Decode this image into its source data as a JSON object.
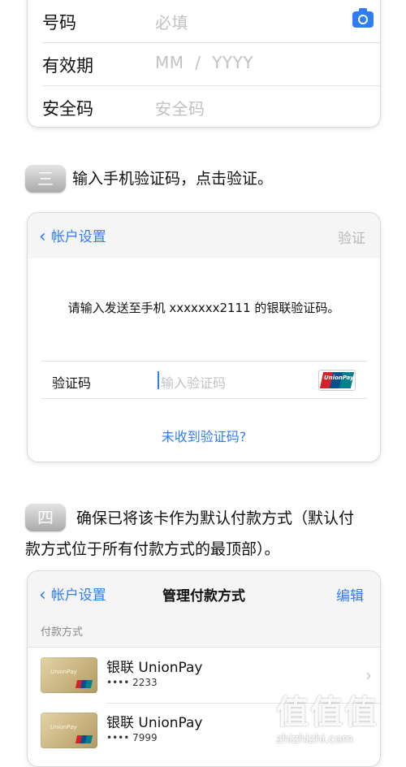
{
  "form": {
    "rows": [
      {
        "label": "号码",
        "placeholder": "必填"
      },
      {
        "label": "有效期",
        "placeholder": "MM  /  YYYY"
      },
      {
        "label": "安全码",
        "placeholder": "安全码"
      }
    ],
    "camera_icon": "camera-icon"
  },
  "step3": {
    "badge": "三",
    "text": "输入手机验证码，点击验证。"
  },
  "verify_screen": {
    "back_label": "帐户设置",
    "right_label": "验证",
    "message": "请输入发送至手机 xxxxxxx2111 的银联验证码。",
    "code_label": "验证码",
    "code_placeholder": "输入验证码",
    "unionpay_logo_text": "UnionPay",
    "resend_link": "未收到验证码?"
  },
  "step4": {
    "badge": "四",
    "text_line1": "确保已将该卡作为默认付款方式（默认付",
    "text_line2": "款方式位于所有付款方式的最顶部）。"
  },
  "manage_screen": {
    "back_label": "帐户设置",
    "title": "管理付款方式",
    "edit_label": "编辑",
    "section_header": "付款方式",
    "cards": [
      {
        "name": "银联 UnionPay",
        "number": "•••• 2233",
        "brand": "UnionPay"
      },
      {
        "name": "银联 UnionPay",
        "number": "•••• 7999",
        "brand": "UnionPay"
      }
    ]
  },
  "watermark": {
    "chars": "值值值",
    "url": "zhizhizhi.com"
  },
  "colors": {
    "accent": "#2f7df6",
    "placeholder": "#c2c2c6",
    "unionpay_red": "#d2232a",
    "unionpay_blue": "#0a4d8c",
    "unionpay_teal": "#00808a"
  }
}
